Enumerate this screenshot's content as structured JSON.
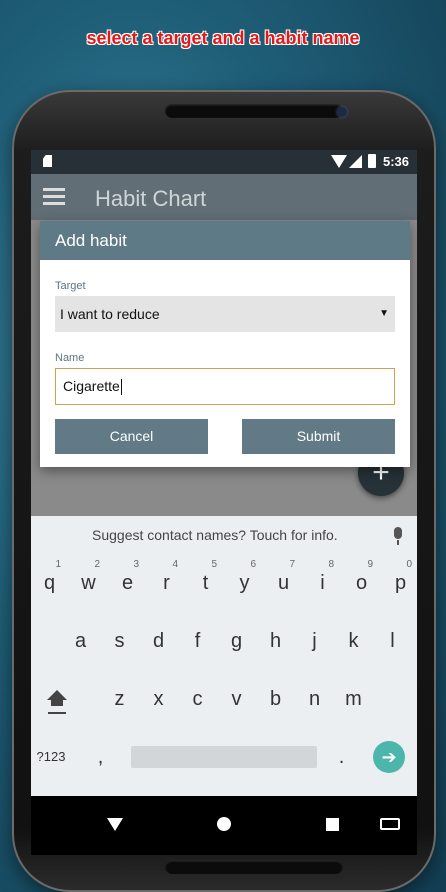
{
  "caption": "select a target and a habit name",
  "status_bar": {
    "time": "5:36"
  },
  "app_bar": {
    "title": "Habit Chart"
  },
  "dialog": {
    "title": "Add habit",
    "target_label": "Target",
    "target_value": "I want to reduce",
    "name_label": "Name",
    "name_value": "Cigarette",
    "cancel_label": "Cancel",
    "submit_label": "Submit"
  },
  "fab": {
    "label": "+"
  },
  "keyboard": {
    "suggestion": "Suggest contact names? Touch for info.",
    "row1": [
      "q",
      "w",
      "e",
      "r",
      "t",
      "y",
      "u",
      "i",
      "o",
      "p"
    ],
    "row1_hints": [
      "1",
      "2",
      "3",
      "4",
      "5",
      "6",
      "7",
      "8",
      "9",
      "0"
    ],
    "row2": [
      "a",
      "s",
      "d",
      "f",
      "g",
      "h",
      "j",
      "k",
      "l"
    ],
    "row3": [
      "z",
      "x",
      "c",
      "v",
      "b",
      "n",
      "m"
    ],
    "symbols_key": "?123",
    "comma": ",",
    "period": "."
  },
  "colors": {
    "caption": "#e01a1a",
    "app_bar": "#616e76",
    "dialog_header": "#5f7a87",
    "button": "#617a86",
    "enter_key": "#4db6ac"
  },
  "icons": [
    "hamburger-menu-icon",
    "wifi-icon",
    "signal-icon",
    "battery-icon",
    "sd-card-icon",
    "mic-icon",
    "shift-icon",
    "backspace-icon",
    "enter-arrow-icon",
    "back-nav-icon",
    "home-nav-icon",
    "recents-nav-icon",
    "keyboard-switch-icon"
  ]
}
